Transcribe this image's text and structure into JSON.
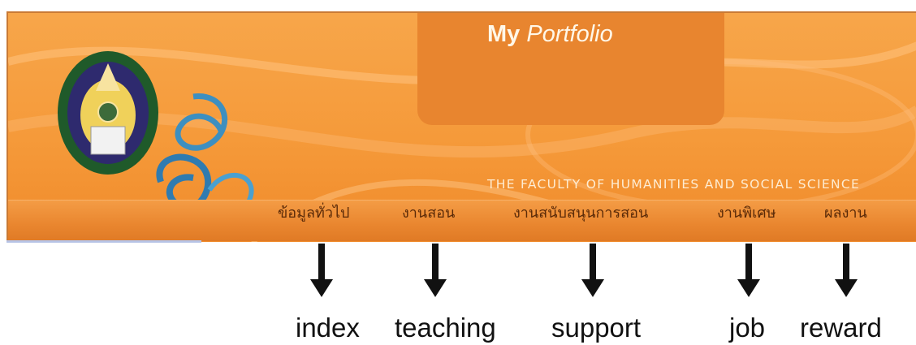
{
  "header": {
    "title_bold": "My",
    "title_italic": "Portfolio",
    "faculty": "THE FACULTY OF HUMANITIES AND SOCIAL SCIENCE"
  },
  "nav": {
    "items": [
      "ข้อมูลทั่วไป",
      "งานสอน",
      "งานสนับสนุนการสอน",
      "งานพิเศษ",
      "ผลงาน"
    ]
  },
  "annotations": {
    "labels": [
      "index",
      "teaching",
      "support",
      "job",
      "reward"
    ]
  },
  "colors": {
    "banner": "#f59a3a",
    "title_panel": "#e8852f",
    "nav_text": "#5a2a08",
    "arrow": "#111111"
  },
  "icons": {
    "logo": "university-seal-icon",
    "monogram": "calligraphic-monogram-icon"
  }
}
